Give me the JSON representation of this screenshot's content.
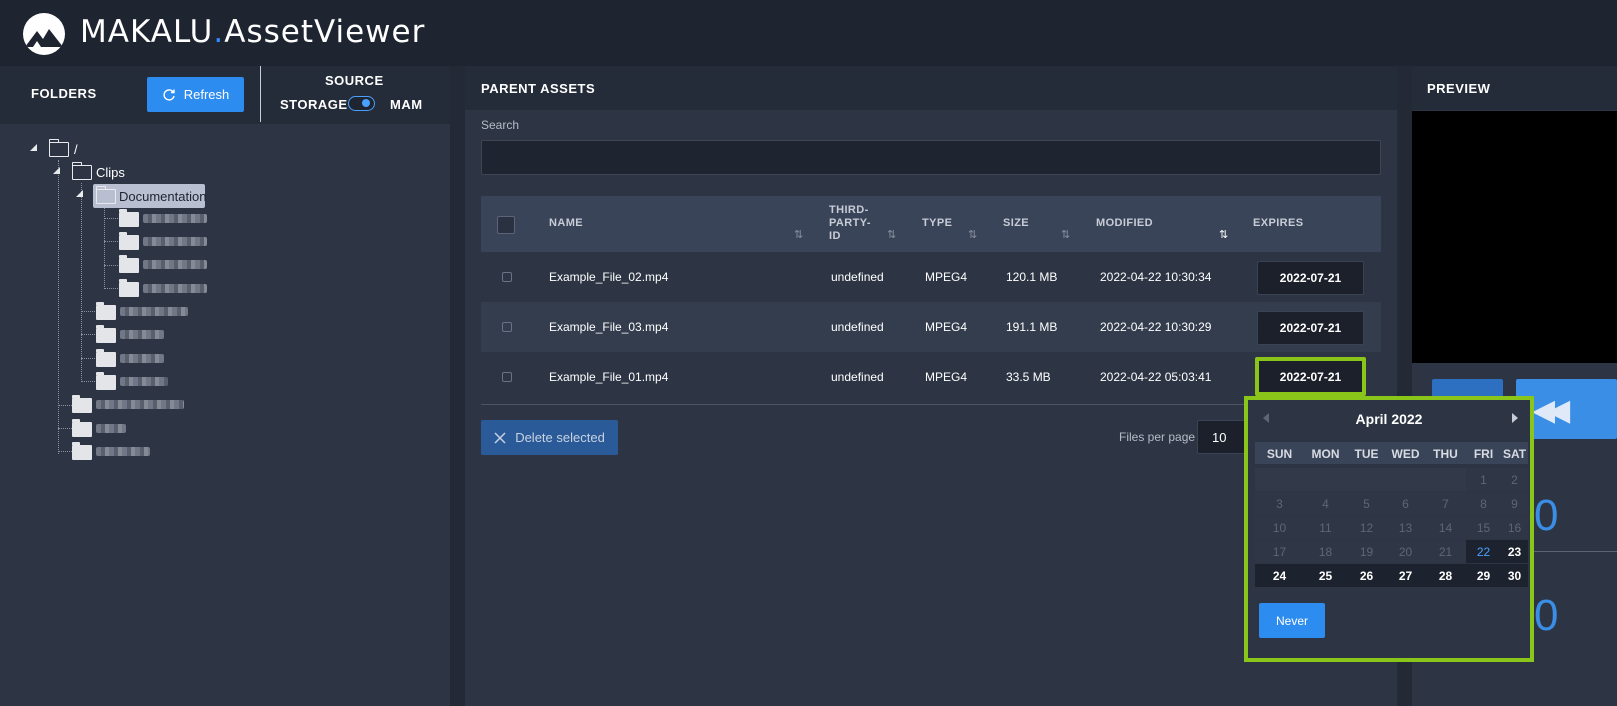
{
  "app": {
    "title_part1": "MAKALU",
    "title_dot": ".",
    "title_part2": "AssetViewer"
  },
  "folders_panel": {
    "title": "FOLDERS",
    "refresh_label": "Refresh",
    "source_title": "SOURCE",
    "storage_label": "STORAGE",
    "mam_label": "MAM",
    "tree": {
      "root": "/",
      "clips": "Clips",
      "documentation": "Documentation"
    }
  },
  "assets_panel": {
    "title": "PARENT ASSETS",
    "search_label": "Search",
    "search_value": "",
    "columns": [
      "NAME",
      "THIRD-PARTY-ID",
      "TYPE",
      "SIZE",
      "MODIFIED",
      "EXPIRES"
    ],
    "column_header_lines": {
      "third_party_1": "THIRD-",
      "third_party_2": "PARTY-",
      "third_party_3": "ID"
    },
    "rows": [
      {
        "name": "Example_File_02.mp4",
        "third_party_id": "undefined",
        "type": "MPEG4",
        "size": "120.1 MB",
        "modified": "2022-04-22 10:30:34",
        "expires": "2022-07-21"
      },
      {
        "name": "Example_File_03.mp4",
        "third_party_id": "undefined",
        "type": "MPEG4",
        "size": "191.1 MB",
        "modified": "2022-04-22 10:30:29",
        "expires": "2022-07-21"
      },
      {
        "name": "Example_File_01.mp4",
        "third_party_id": "undefined",
        "type": "MPEG4",
        "size": "33.5 MB",
        "modified": "2022-04-22 05:03:41",
        "expires": "2022-07-21"
      }
    ],
    "delete_label": "Delete selected",
    "files_per_page_label": "Files per page",
    "files_per_page_value": "10"
  },
  "preview_panel": {
    "title": "PREVIEW",
    "partial_number_1": "0",
    "partial_number_2": "0"
  },
  "calendar": {
    "month": "April",
    "year": "2022",
    "days_of_week": [
      "SUN",
      "MON",
      "TUE",
      "WED",
      "THU",
      "FRI",
      "SAT"
    ],
    "weeks": [
      [
        "",
        "",
        "",
        "",
        "",
        "1",
        "2"
      ],
      [
        "3",
        "4",
        "5",
        "6",
        "7",
        "8",
        "9"
      ],
      [
        "10",
        "11",
        "12",
        "13",
        "14",
        "15",
        "16"
      ],
      [
        "17",
        "18",
        "19",
        "20",
        "21",
        "22",
        "23"
      ],
      [
        "24",
        "25",
        "26",
        "27",
        "28",
        "29",
        "30"
      ]
    ],
    "today": "22",
    "first_selectable": "23",
    "never_label": "Never"
  },
  "colors": {
    "accent": "#2d8cf0",
    "highlight": "#8ac51a",
    "panel": "#2d3544",
    "header": "#1e2430"
  }
}
